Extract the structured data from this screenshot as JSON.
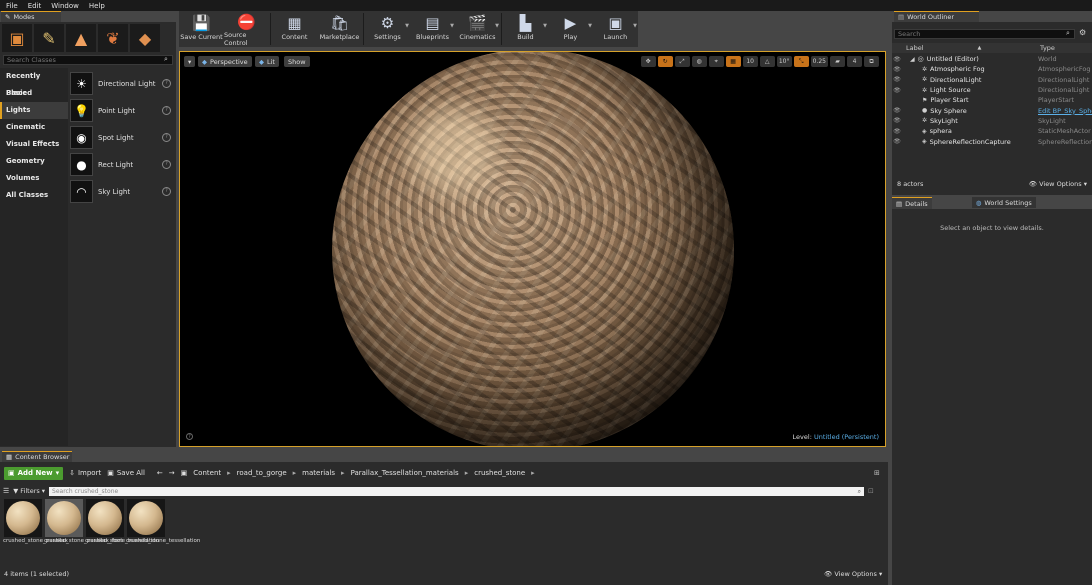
{
  "menu": [
    "File",
    "Edit",
    "Window",
    "Help"
  ],
  "modes": {
    "tab_label": "Modes",
    "search_placeholder": "Search Classes",
    "categories": [
      "Recently Placed",
      "Basic",
      "Lights",
      "Cinematic",
      "Visual Effects",
      "Geometry",
      "Volumes",
      "All Classes"
    ],
    "selected_category": "Lights",
    "items": [
      "Directional Light",
      "Point Light",
      "Spot Light",
      "Rect Light",
      "Sky Light"
    ]
  },
  "toolbar": {
    "buttons": [
      "Save Current",
      "Source Control",
      "Content",
      "Marketplace",
      "Settings",
      "Blueprints",
      "Cinematics",
      "Build",
      "Play",
      "Launch"
    ]
  },
  "viewport": {
    "perspective_label": "Perspective",
    "lit_label": "Lit",
    "show_label": "Show",
    "grid_snap": "10",
    "rot_snap": "10°",
    "scale_snap": "0.25",
    "camera_speed": "4",
    "level_label": "Level:",
    "level_value": "Untitled (Persistent)"
  },
  "outliner": {
    "tab_label": "World Outliner",
    "search_placeholder": "Search",
    "col_label": "Label",
    "col_type": "Type",
    "rows": [
      {
        "label": "Untitled (Editor)",
        "type": "World"
      },
      {
        "label": "Atmospheric Fog",
        "type": "AtmosphericFog"
      },
      {
        "label": "DirectionalLight",
        "type": "DirectionalLight"
      },
      {
        "label": "Light Source",
        "type": "DirectionalLight"
      },
      {
        "label": "Player Start",
        "type": "PlayerStart"
      },
      {
        "label": "Sky Sphere",
        "type": "Edit BP_Sky_Sphere"
      },
      {
        "label": "SkyLight",
        "type": "SkyLight"
      },
      {
        "label": "sphera",
        "type": "StaticMeshActor"
      },
      {
        "label": "SphereReflectionCapture",
        "type": "SphereReflectionCapture"
      }
    ],
    "actor_count": "8 actors",
    "view_options": "View Options"
  },
  "details": {
    "tab_details": "Details",
    "tab_world": "World Settings",
    "empty_message": "Select an object to view details."
  },
  "content_browser": {
    "tab_label": "Content Browser",
    "add_new": "Add New",
    "import": "Import",
    "save_all": "Save All",
    "path": [
      "Content",
      "road_to_gorge",
      "materials",
      "Parallax_Tessellation_materials",
      "crushed_stone"
    ],
    "filters": "Filters",
    "search_placeholder": "Search crushed_stone",
    "assets": [
      "crushed_stone_parallax",
      "crushed_stone_parallax_foot",
      "crushed_stone_tessellation",
      "crushed_stone_tessellation"
    ],
    "status": "4 items (1 selected)",
    "view_options": "View Options"
  }
}
